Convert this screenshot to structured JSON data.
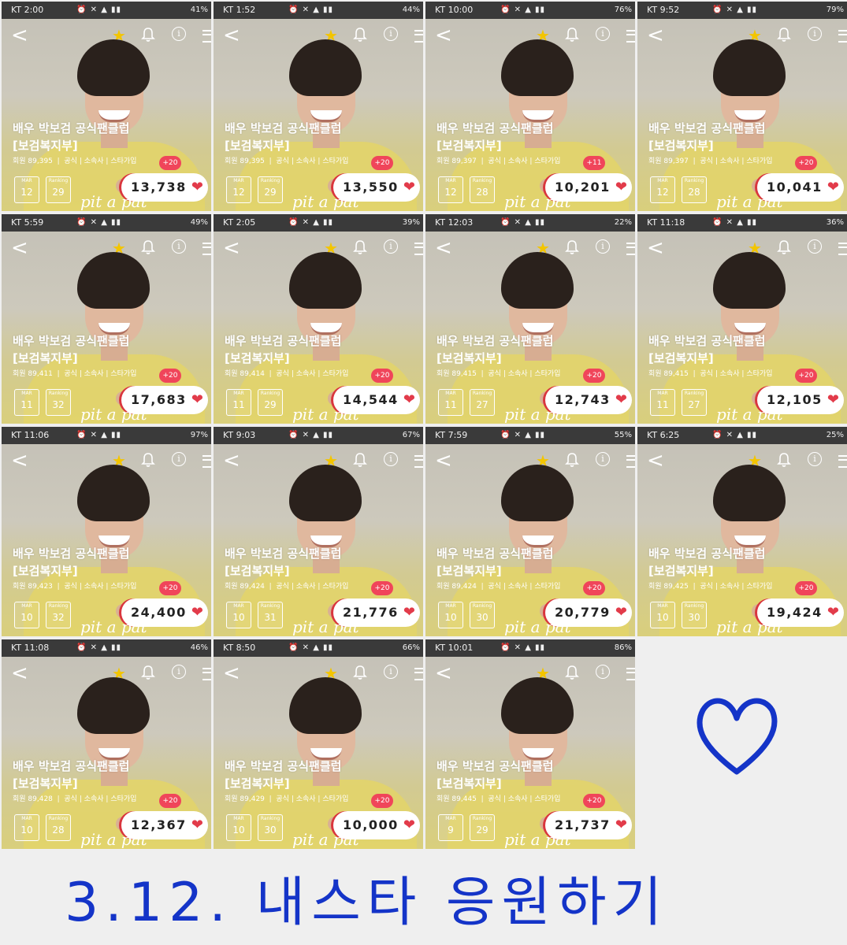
{
  "nav": {
    "back": "<",
    "star": "★",
    "info": "i"
  },
  "profile": {
    "title_line1": "배우 박보검 공식팬클럽",
    "title_line2": "[보검복지부]",
    "meta_tags": "공식 | 소속사 | 스타가입",
    "month_label": "MAR",
    "rank_label": "Ranking",
    "signature": "pit a pat"
  },
  "screenshots": [
    {
      "time": "KT 2:00",
      "status": "41%",
      "members": "회원 89,395",
      "plus": "+20",
      "day": "12",
      "rank": "29",
      "score": "13,738"
    },
    {
      "time": "KT 1:52",
      "status": "44%",
      "members": "회원 89,395",
      "plus": "+20",
      "day": "12",
      "rank": "29",
      "score": "13,550"
    },
    {
      "time": "KT 10:00",
      "status": "76%",
      "members": "회원 89,397",
      "plus": "+11",
      "day": "12",
      "rank": "28",
      "score": "10,201"
    },
    {
      "time": "KT 9:52",
      "status": "79%",
      "members": "회원 89,397",
      "plus": "+20",
      "day": "12",
      "rank": "28",
      "score": "10,041"
    },
    {
      "time": "KT 5:59",
      "status": "49%",
      "members": "회원 89,411",
      "plus": "+20",
      "day": "11",
      "rank": "32",
      "score": "17,683"
    },
    {
      "time": "KT 2:05",
      "status": "39%",
      "members": "회원 89,414",
      "plus": "+20",
      "day": "11",
      "rank": "29",
      "score": "14,544"
    },
    {
      "time": "KT 12:03",
      "status": "22%",
      "members": "회원 89,415",
      "plus": "+20",
      "day": "11",
      "rank": "27",
      "score": "12,743"
    },
    {
      "time": "KT 11:18",
      "status": "36%",
      "members": "회원 89,415",
      "plus": "+20",
      "day": "11",
      "rank": "27",
      "score": "12,105"
    },
    {
      "time": "KT 11:06",
      "status": "97%",
      "members": "회원 89,423",
      "plus": "+20",
      "day": "10",
      "rank": "32",
      "score": "24,400"
    },
    {
      "time": "KT 9:03",
      "status": "67%",
      "members": "회원 89,424",
      "plus": "+20",
      "day": "10",
      "rank": "31",
      "score": "21,776"
    },
    {
      "time": "KT 7:59",
      "status": "55%",
      "members": "회원 89,424",
      "plus": "+20",
      "day": "10",
      "rank": "30",
      "score": "20,779"
    },
    {
      "time": "KT 6:25",
      "status": "25%",
      "members": "회원 89,425",
      "plus": "+20",
      "day": "10",
      "rank": "30",
      "score": "19,424"
    },
    {
      "time": "KT 11:08",
      "status": "46%",
      "members": "회원 89,428",
      "plus": "+20",
      "day": "10",
      "rank": "28",
      "score": "12,367"
    },
    {
      "time": "KT 8:50",
      "status": "66%",
      "members": "회원 89,429",
      "plus": "+20",
      "day": "10",
      "rank": "30",
      "score": "10,000"
    },
    {
      "time": "KT 10:01",
      "status": "86%",
      "members": "회원 89,445",
      "plus": "+20",
      "day": "9",
      "rank": "29",
      "score": "21,737"
    }
  ],
  "caption": "3.12. 내스타 응원하기",
  "colors": {
    "accent_heart": "#e23b4a",
    "caption_blue": "#1434c8",
    "statusbar": "#3a3a3a"
  }
}
